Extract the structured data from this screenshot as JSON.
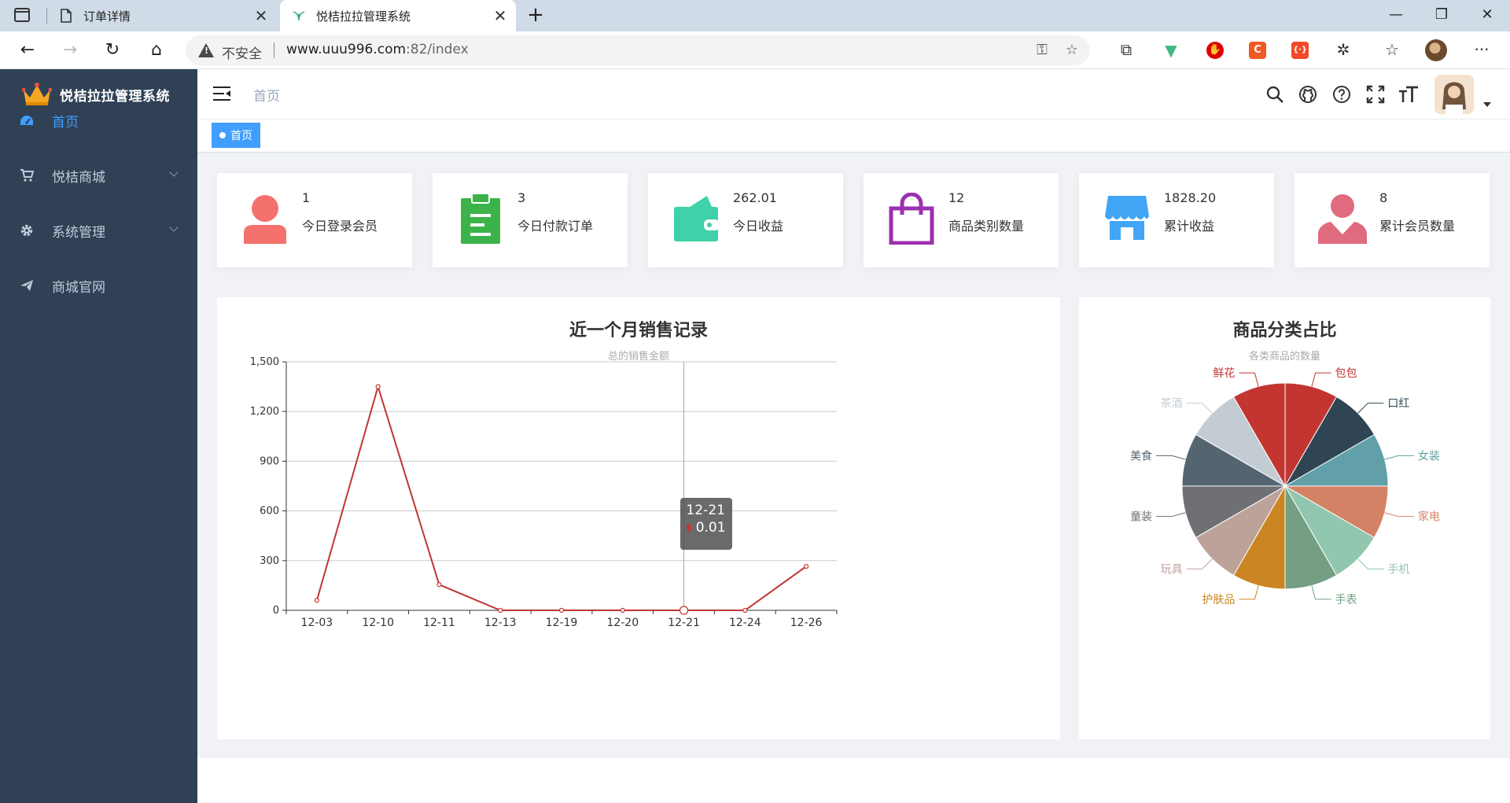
{
  "browser": {
    "tabs": [
      {
        "title": "订单详情",
        "icon": "document-icon",
        "close": "✕"
      },
      {
        "title": "悦桔拉拉管理系统",
        "icon": "plant-icon",
        "close": "✕"
      }
    ],
    "new_tab": "+",
    "window_controls": {
      "minimize": "—",
      "maximize": "❐",
      "close": "✕"
    },
    "nav": {
      "back": "←",
      "forward": "→",
      "reload": "↻",
      "home": "⌂"
    },
    "security_label": "不安全",
    "url_host": "www.uuu996.com",
    "url_rest": ":82/index",
    "extensions": [
      {
        "name": "vue-devtools-extension",
        "label": "▼",
        "color": "#42b883"
      },
      {
        "name": "adblock-extension",
        "label": "✋",
        "color": "#e00000"
      },
      {
        "name": "c-extension",
        "label": "C",
        "color": "#f05a22"
      },
      {
        "name": "json-extension",
        "label": "{·}",
        "color": "#f04a2a"
      }
    ],
    "more": "···"
  },
  "sidebar": {
    "brand": "悦桔拉拉管理系统",
    "items": [
      {
        "label": "首页",
        "icon": "dashboard-icon",
        "active": true,
        "has_arrow": false
      },
      {
        "label": "悦桔商城",
        "icon": "cart-icon",
        "active": false,
        "has_arrow": true
      },
      {
        "label": "系统管理",
        "icon": "gear-icon",
        "active": false,
        "has_arrow": true
      },
      {
        "label": "商城官网",
        "icon": "paper-plane-icon",
        "active": false,
        "has_arrow": false
      }
    ]
  },
  "navbar": {
    "breadcrumb": "首页",
    "icons": [
      "search-icon",
      "github-icon",
      "help-icon",
      "fullscreen-icon",
      "font-size-icon"
    ]
  },
  "tags": [
    {
      "label": "首页",
      "active": true
    }
  ],
  "stats": [
    {
      "value": "1",
      "label": "今日登录会员",
      "icon": "user-icon",
      "color": "#f4716e"
    },
    {
      "value": "3",
      "label": "今日付款订单",
      "icon": "clipboard-icon",
      "color": "#3cb34a"
    },
    {
      "value": "262.01",
      "label": "今日收益",
      "icon": "wallet-icon",
      "color": "#3fd1a8"
    },
    {
      "value": "12",
      "label": "商品类别数量",
      "icon": "shopping-bag-icon",
      "color": "#9b30b0"
    },
    {
      "value": "1828.20",
      "label": "累计收益",
      "icon": "storefront-icon",
      "color": "#42a5f5"
    },
    {
      "value": "8",
      "label": "累计会员数量",
      "icon": "member-icon",
      "color": "#e06a7e"
    }
  ],
  "sales_chart": {
    "title": "近一个月销售记录",
    "subtitle": "总的销售金额"
  },
  "pie_chart": {
    "title": "商品分类占比",
    "subtitle": "各类商品的数量"
  },
  "tooltip": {
    "date": "12-21",
    "value": "0.01"
  },
  "chart_data": [
    {
      "type": "line",
      "title": "近一个月销售记录",
      "subtitle": "总的销售金额",
      "categories": [
        "12-03",
        "12-10",
        "12-11",
        "12-13",
        "12-19",
        "12-20",
        "12-21",
        "12-24",
        "12-26"
      ],
      "values": [
        60,
        1350,
        155,
        0,
        0,
        0,
        0.01,
        0,
        265
      ],
      "ylim": [
        0,
        1500
      ],
      "yticks": [
        0,
        300,
        600,
        900,
        1200,
        1500
      ],
      "ytick_labels": [
        "0",
        "300",
        "600",
        "900",
        "1,200",
        "1,500"
      ],
      "grid": true,
      "color": "#c23531",
      "highlight_index": 6
    },
    {
      "type": "pie",
      "title": "商品分类占比",
      "subtitle": "各类商品的数量",
      "slices": [
        {
          "label": "包包",
          "value": 1,
          "color": "#c23531"
        },
        {
          "label": "口红",
          "value": 1,
          "color": "#2f4554"
        },
        {
          "label": "女装",
          "value": 1,
          "color": "#61a0a8"
        },
        {
          "label": "家电",
          "value": 1,
          "color": "#d48265"
        },
        {
          "label": "手机",
          "value": 1,
          "color": "#91c7ae"
        },
        {
          "label": "手表",
          "value": 1,
          "color": "#749f83"
        },
        {
          "label": "护肤品",
          "value": 1,
          "color": "#ca8622"
        },
        {
          "label": "玩具",
          "value": 1,
          "color": "#bda29a"
        },
        {
          "label": "童装",
          "value": 1,
          "color": "#6e7074"
        },
        {
          "label": "美食",
          "value": 1,
          "color": "#546570"
        },
        {
          "label": "茶酒",
          "value": 1,
          "color": "#c4ccd3"
        },
        {
          "label": "鲜花",
          "value": 1,
          "color": "#c23531"
        }
      ]
    }
  ]
}
